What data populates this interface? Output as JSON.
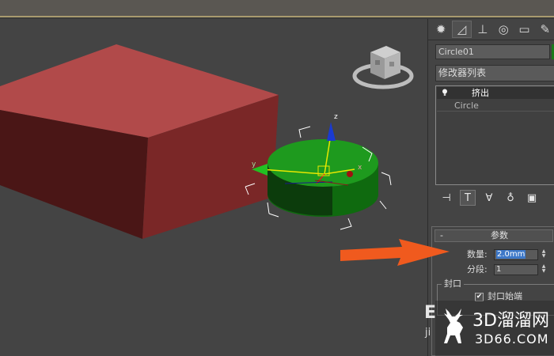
{
  "viewport": {
    "gizmo_axes": {
      "x": "x",
      "y": "y",
      "z": "z"
    }
  },
  "command_panel": {
    "tabs": [
      {
        "icon": "sun-gear-icon",
        "glyph": "✹"
      },
      {
        "icon": "modify-curve-icon",
        "glyph": "◿"
      },
      {
        "icon": "hierarchy-icon",
        "glyph": "⊥"
      },
      {
        "icon": "motion-icon",
        "glyph": "◎"
      },
      {
        "icon": "display-icon",
        "glyph": "▭"
      },
      {
        "icon": "utilities-wrench-icon",
        "glyph": "✎"
      }
    ],
    "object_name": "Circle01",
    "object_color": "#1a7a1a",
    "modifier_list_label": "修改器列表",
    "stack": {
      "selected_item": "挤出",
      "sub_item": "Circle"
    },
    "stack_tools": [
      {
        "icon": "pin-stack-icon",
        "glyph": "⊣"
      },
      {
        "icon": "show-end-result-icon",
        "glyph": "T"
      },
      {
        "icon": "make-unique-icon",
        "glyph": "∀"
      },
      {
        "icon": "remove-modifier-icon",
        "glyph": "♁"
      },
      {
        "icon": "configure-sets-icon",
        "glyph": "▣"
      }
    ],
    "parameters": {
      "rollout_toggle": "-",
      "rollout_title": "参数",
      "amount_label": "数量:",
      "amount_value": "2.0mm",
      "segments_label": "分段:",
      "segments_value": "1",
      "capping_group_label": "封口",
      "cap_start_label": "封口始端",
      "cap_start_checked_glyph": "✔"
    }
  },
  "watermark": {
    "fragment_top": "E",
    "fragment_bottom": "ji",
    "name": "3D溜溜网",
    "url": "3D66.COM"
  },
  "colors": {
    "box_top": "#b14a4a",
    "box_front": "#4a1616",
    "box_side": "#7a2727",
    "cylinder": "#1e9a1e",
    "arrow": "#f05a1e",
    "highlight": "#3d78c8"
  }
}
